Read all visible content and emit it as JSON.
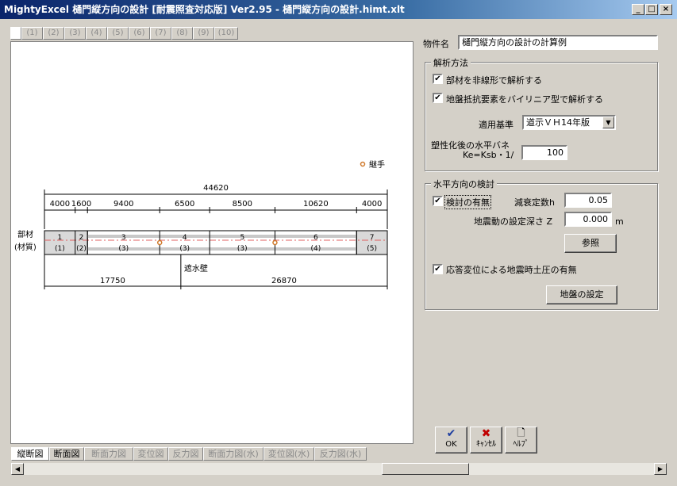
{
  "window": {
    "title": "MightyExcel 樋門縦方向の設計 [耐震照査対応版] Ver2.95 - 樋門縦方向の設計.himt.xlt",
    "minimize": "_",
    "maximize": "□",
    "close": "×"
  },
  "top_tabs": [
    "(1)",
    "(2)",
    "(3)",
    "(4)",
    "(5)",
    "(6)",
    "(7)",
    "(8)",
    "(9)",
    "(10)"
  ],
  "drawing": {
    "legend_label": "継手",
    "total_length": "44620",
    "segment_lengths": [
      "4000",
      "1600",
      "9400",
      "6500",
      "8500",
      "10620",
      "4000"
    ],
    "member_label": "部材",
    "material_label": "(材質)",
    "members": [
      {
        "no": "1",
        "material": "(1)"
      },
      {
        "no": "2",
        "material": "(2)"
      },
      {
        "no": "3",
        "material": "(3)"
      },
      {
        "no": "4",
        "material": "(3)"
      },
      {
        "no": "5",
        "material": "(3)"
      },
      {
        "no": "6",
        "material": "(4)"
      },
      {
        "no": "7",
        "material": "(5)"
      }
    ],
    "cutoff_wall_label": "遮水壁",
    "split_lengths": [
      "17750",
      "26870"
    ]
  },
  "bottom_tabs": [
    "縦断図",
    "断面図",
    "断面力図",
    "変位図",
    "反力図",
    "断面力図(水)",
    "変位図(水)",
    "反力図(水)"
  ],
  "form": {
    "project_label": "物件名",
    "project_value": "樋門縦方向の設計の計算例",
    "analysis_group": "解析方法",
    "chk_nonlinear_label": "部材を非線形で解析する",
    "chk_bilinear_label": "地盤抵抗要素をバイリニア型で解析する",
    "standard_label": "適用基準",
    "standard_value": "道示ＶＨ14年版",
    "spring_label_1": "塑性化後の水平バネ",
    "spring_label_2": "Ke=Ksb・1/",
    "spring_value": "100",
    "horizontal_group": "水平方向の検討",
    "chk_check_label": "検討の有無",
    "damping_label": "減衰定数h",
    "damping_value": "0.05",
    "depth_label": "地震動の設定深さ Z",
    "depth_value": "0.000",
    "depth_unit": "m",
    "ref_button": "参照",
    "chk_response_label": "応答変位による地震時土圧の有無",
    "ground_button": "地盤の設定",
    "ok_label": "OK",
    "cancel_label": "ｷｬﾝｾﾙ",
    "help_label": "ﾍﾙﾌﾟ",
    "check_mark": "✔"
  },
  "colors": {
    "ok_icon": "#1f3fa0",
    "cancel_icon": "#c00000",
    "joint": "#d07a2c"
  }
}
